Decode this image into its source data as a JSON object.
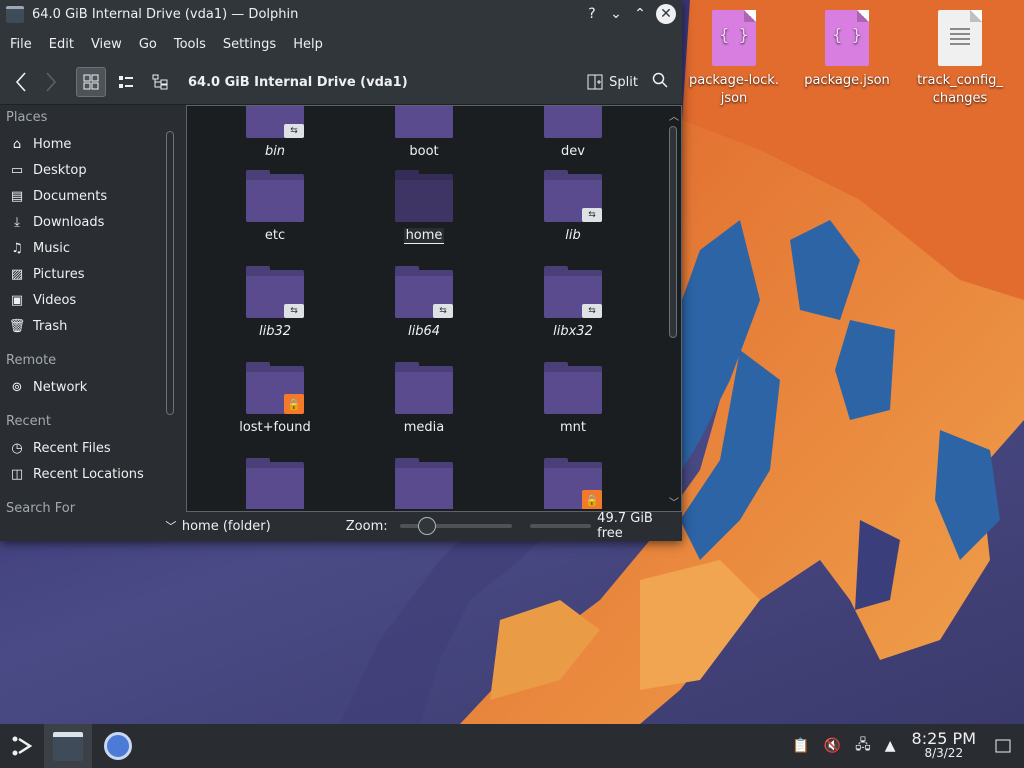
{
  "window": {
    "title": "64.0 GiB Internal Drive (vda1) — Dolphin",
    "help_glyph": "?",
    "minimize_glyph": "⌄",
    "maximize_glyph": "⌃",
    "close_glyph": "✕"
  },
  "menu": [
    "File",
    "Edit",
    "View",
    "Go",
    "Tools",
    "Settings",
    "Help"
  ],
  "toolbar": {
    "path": "64.0 GiB Internal Drive (vda1)",
    "split_label": "Split"
  },
  "places": {
    "places_header": "Places",
    "places_items": [
      {
        "label": "Home",
        "icon": "home-icon"
      },
      {
        "label": "Desktop",
        "icon": "desktop-icon"
      },
      {
        "label": "Documents",
        "icon": "documents-icon"
      },
      {
        "label": "Downloads",
        "icon": "downloads-icon"
      },
      {
        "label": "Music",
        "icon": "music-icon"
      },
      {
        "label": "Pictures",
        "icon": "pictures-icon"
      },
      {
        "label": "Videos",
        "icon": "videos-icon"
      },
      {
        "label": "Trash",
        "icon": "trash-icon"
      }
    ],
    "remote_header": "Remote",
    "remote_items": [
      {
        "label": "Network",
        "icon": "network-icon"
      }
    ],
    "recent_header": "Recent",
    "recent_items": [
      {
        "label": "Recent Files",
        "icon": "recent-files-icon"
      },
      {
        "label": "Recent Locations",
        "icon": "recent-locations-icon"
      }
    ],
    "search_header": "Search For"
  },
  "folders": [
    {
      "name": "bin",
      "italic": true,
      "badge": "link"
    },
    {
      "name": "boot",
      "italic": false,
      "badge": ""
    },
    {
      "name": "dev",
      "italic": false,
      "badge": ""
    },
    {
      "name": "etc",
      "italic": false,
      "badge": ""
    },
    {
      "name": "home",
      "italic": false,
      "badge": "",
      "selected": true
    },
    {
      "name": "lib",
      "italic": true,
      "badge": "link"
    },
    {
      "name": "lib32",
      "italic": true,
      "badge": "link"
    },
    {
      "name": "lib64",
      "italic": true,
      "badge": "link"
    },
    {
      "name": "libx32",
      "italic": true,
      "badge": "link"
    },
    {
      "name": "lost+found",
      "italic": false,
      "badge": "lock"
    },
    {
      "name": "media",
      "italic": false,
      "badge": ""
    },
    {
      "name": "mnt",
      "italic": false,
      "badge": ""
    },
    {
      "name": "",
      "italic": false,
      "badge": ""
    },
    {
      "name": "",
      "italic": false,
      "badge": ""
    },
    {
      "name": "",
      "italic": false,
      "badge": "lock"
    }
  ],
  "status": {
    "selection": "home (folder)",
    "zoom_label": "Zoom:",
    "free_space": "49.7 GiB free"
  },
  "desktop_icons": [
    {
      "label": "package-lock.\njson",
      "type": "json"
    },
    {
      "label": "package.json",
      "type": "json"
    },
    {
      "label": "track_config_\nchanges",
      "type": "txt"
    }
  ],
  "taskbar": {
    "time": "8:25 PM",
    "date": "8/3/22"
  },
  "colors": {
    "window_bg": "#2a2e32",
    "accent_orange": "#f47a2a",
    "folder_purple": "#5a4b8e",
    "wallpaper_orange": "#e8823a",
    "wallpaper_blue": "#2f6aa8"
  }
}
